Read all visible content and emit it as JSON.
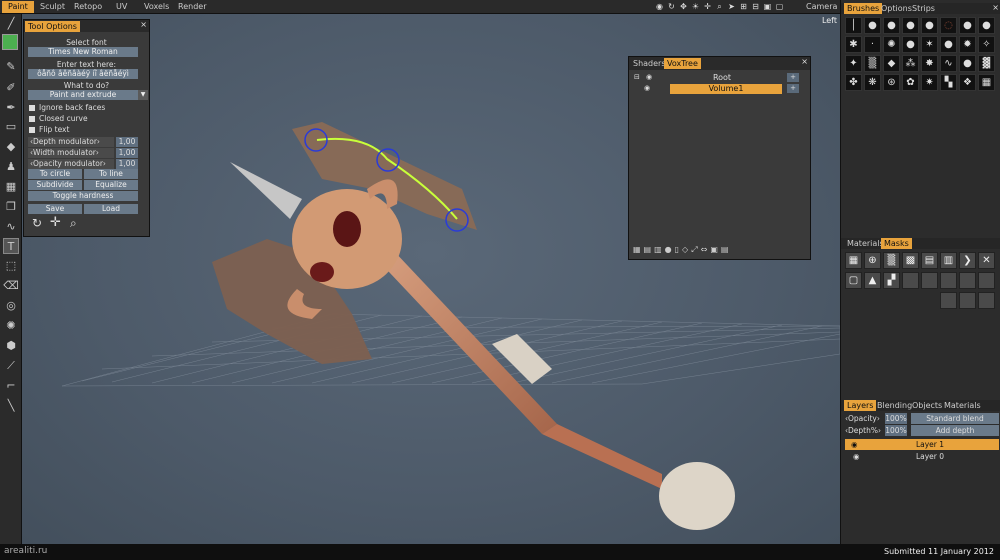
{
  "menu": {
    "tabs": [
      "Paint",
      "Sculpt",
      "Retopo",
      "UV",
      "Voxels",
      "Render"
    ],
    "active": "Paint",
    "camera_label": "Camera",
    "view_label": "Left"
  },
  "tool_options": {
    "tab": "Tool Options",
    "select_font_label": "Select font",
    "font_value": "Times New Roman",
    "enter_text_label": "Enter text here:",
    "text_value": "ôåñô âêñâàéÿ íî âëñåéÿì",
    "what_to_do_label": "What to do?",
    "mode_value": "Paint and extrude",
    "checkboxes": [
      "Ignore back faces",
      "Closed curve",
      "Flip text"
    ],
    "sliders": [
      {
        "label": "‹Depth modulator›",
        "value": "1,00"
      },
      {
        "label": "‹Width modulator›",
        "value": "1,00"
      },
      {
        "label": "‹Opacity modulator›",
        "value": "1,00"
      }
    ],
    "buttons": {
      "to_circle": "To circle",
      "to_line": "To line",
      "subdivide": "Subdivide",
      "equalize": "Equalize",
      "toggle_hardness": "Toggle hardness",
      "save": "Save",
      "load": "Load"
    },
    "colors": {
      "accent": "#e8a33c",
      "swatch": "#4caf50"
    }
  },
  "voxtree": {
    "tabs": [
      "Shaders",
      "VoxTree"
    ],
    "active": "VoxTree",
    "items": [
      {
        "name": "Root"
      },
      {
        "name": "Volume1",
        "selected": true
      }
    ]
  },
  "right": {
    "brushes_tabs": [
      "Brushes",
      "Options",
      "Strips"
    ],
    "materials_tabs": [
      "Materials",
      "Masks"
    ],
    "layers_tabs": [
      "Layers",
      "Blending",
      "Objects",
      "Materials"
    ],
    "opacity_label": "‹Opacity›",
    "opacity_value": "100%",
    "blend_value": "Standard blend",
    "depth_label": "‹Depth%›",
    "depth_value": "100%",
    "add_depth_label": "Add depth",
    "layers": [
      {
        "name": "Layer 1",
        "selected": true
      },
      {
        "name": "Layer 0",
        "selected": false
      }
    ]
  },
  "status": {
    "watermark": "arealiti.ru",
    "submitted": "Submitted 11 January 2012"
  }
}
